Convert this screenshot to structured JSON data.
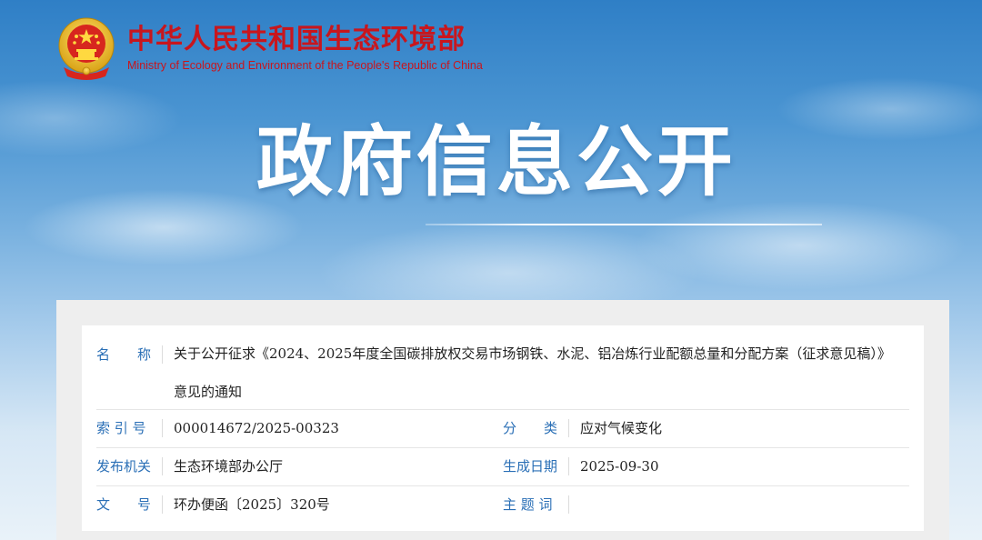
{
  "header": {
    "org_name_cn": "中华人民共和国生态环境部",
    "org_name_en": "Ministry of Ecology and Environment of the People's Republic of China"
  },
  "banner": {
    "title": "政府信息公开"
  },
  "info": {
    "name_label": "名　　称",
    "name_value": "关于公开征求《2024、2025年度全国碳排放权交易市场钢铁、水泥、铝冶炼行业配额总量和分配方案（征求意见稿）》意见的通知",
    "index_label": "索 引 号",
    "index_value": "000014672/2025-00323",
    "category_label": "分　　类",
    "category_value": "应对气候变化",
    "issuer_label": "发布机关",
    "issuer_value": "生态环境部办公厅",
    "date_label": "生成日期",
    "date_value": "2025-09-30",
    "doc_no_label": "文　　号",
    "doc_no_value": "环办便函〔2025〕320号",
    "subject_label": "主 题 词",
    "subject_value": ""
  },
  "colors": {
    "brand_red": "#c8161d",
    "label_blue": "#2a6fb6",
    "sky_top": "#2f7fc6"
  }
}
